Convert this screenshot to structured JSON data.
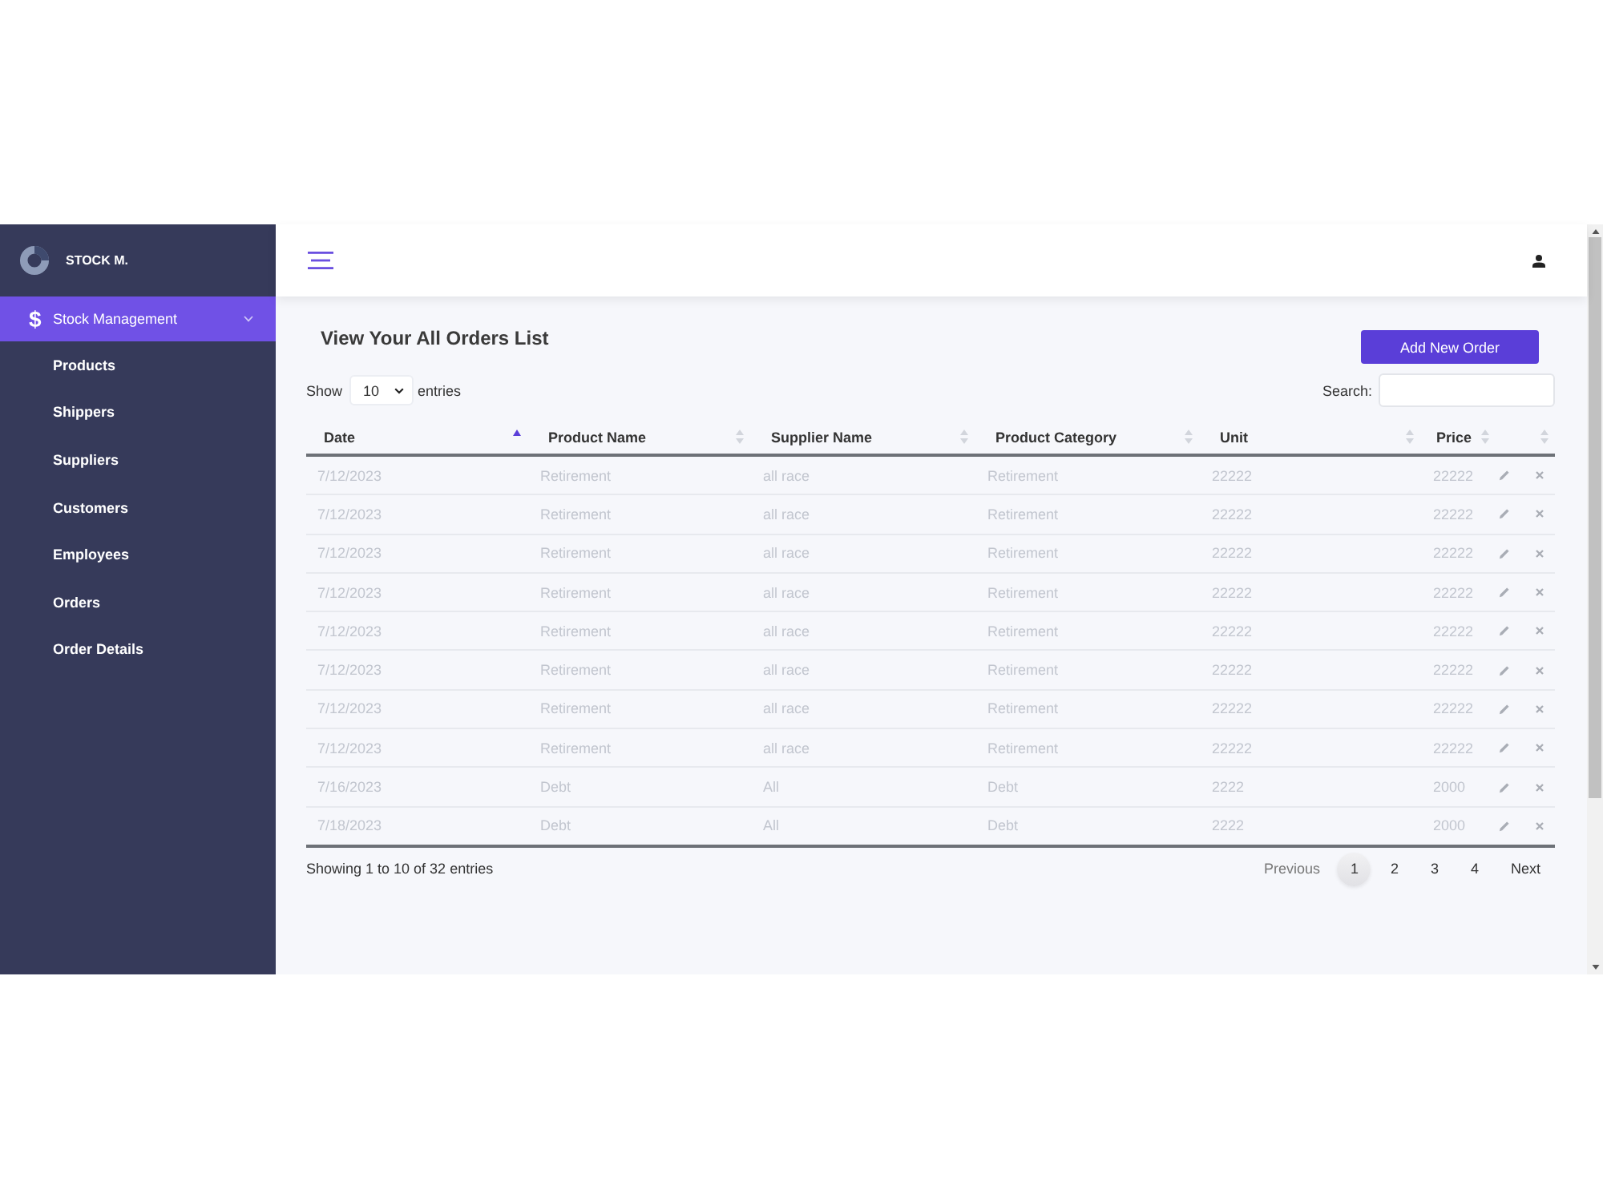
{
  "sidebar": {
    "brand": "STOCK M.",
    "menu": {
      "icon": "$",
      "label": "Stock Management",
      "selected": true,
      "expanded": true
    },
    "items": [
      {
        "label": "Products",
        "selected": false
      },
      {
        "label": "Shippers",
        "selected": false
      },
      {
        "label": "Suppliers",
        "selected": false
      },
      {
        "label": "Customers",
        "selected": false
      },
      {
        "label": "Employees",
        "selected": false
      },
      {
        "label": "Orders",
        "selected": false
      },
      {
        "label": "Order Details",
        "selected": false
      }
    ]
  },
  "header": {
    "title": "View Your All Orders List",
    "add_button": "Add New Order"
  },
  "controls": {
    "show_label": "Show",
    "page_size": "10",
    "entries_label": "entries",
    "search_label": "Search:"
  },
  "table": {
    "columns": [
      {
        "kind": "data",
        "label": "Date",
        "sorted": true
      },
      {
        "kind": "data",
        "label": "Product Name",
        "sorted": false
      },
      {
        "kind": "data",
        "label": "Supplier Name",
        "sorted": false
      },
      {
        "kind": "data",
        "label": "Product Category",
        "sorted": false
      },
      {
        "kind": "data",
        "label": "Unit",
        "sorted": false
      },
      {
        "kind": "data",
        "label": "Price",
        "sorted": false
      },
      {
        "kind": "actions",
        "sorted": false
      }
    ],
    "rows": [
      {
        "cells": [
          "7/12/2023",
          "Retirement",
          "all race",
          "Retirement",
          "22222",
          "22222"
        ]
      },
      {
        "cells": [
          "7/12/2023",
          "Retirement",
          "all race",
          "Retirement",
          "22222",
          "22222"
        ]
      },
      {
        "cells": [
          "7/12/2023",
          "Retirement",
          "all race",
          "Retirement",
          "22222",
          "22222"
        ]
      },
      {
        "cells": [
          "7/12/2023",
          "Retirement",
          "all race",
          "Retirement",
          "22222",
          "22222"
        ]
      },
      {
        "cells": [
          "7/12/2023",
          "Retirement",
          "all race",
          "Retirement",
          "22222",
          "22222"
        ]
      },
      {
        "cells": [
          "7/12/2023",
          "Retirement",
          "all race",
          "Retirement",
          "22222",
          "22222"
        ]
      },
      {
        "cells": [
          "7/12/2023",
          "Retirement",
          "all race",
          "Retirement",
          "22222",
          "22222"
        ]
      },
      {
        "cells": [
          "7/12/2023",
          "Retirement",
          "all race",
          "Retirement",
          "22222",
          "22222"
        ]
      },
      {
        "cells": [
          "7/16/2023",
          "Debt",
          "All",
          "Debt",
          "2222",
          "2000"
        ]
      },
      {
        "cells": [
          "7/18/2023",
          "Debt",
          "All",
          "Debt",
          "2222",
          "2000"
        ]
      }
    ]
  },
  "footer": {
    "info": "Showing 1 to 10 of 32 entries",
    "previous": "Previous",
    "next": "Next",
    "pages": [
      {
        "label": "1",
        "selected": true
      },
      {
        "label": "2",
        "selected": false
      },
      {
        "label": "3",
        "selected": false
      },
      {
        "label": "4",
        "selected": false
      }
    ]
  }
}
